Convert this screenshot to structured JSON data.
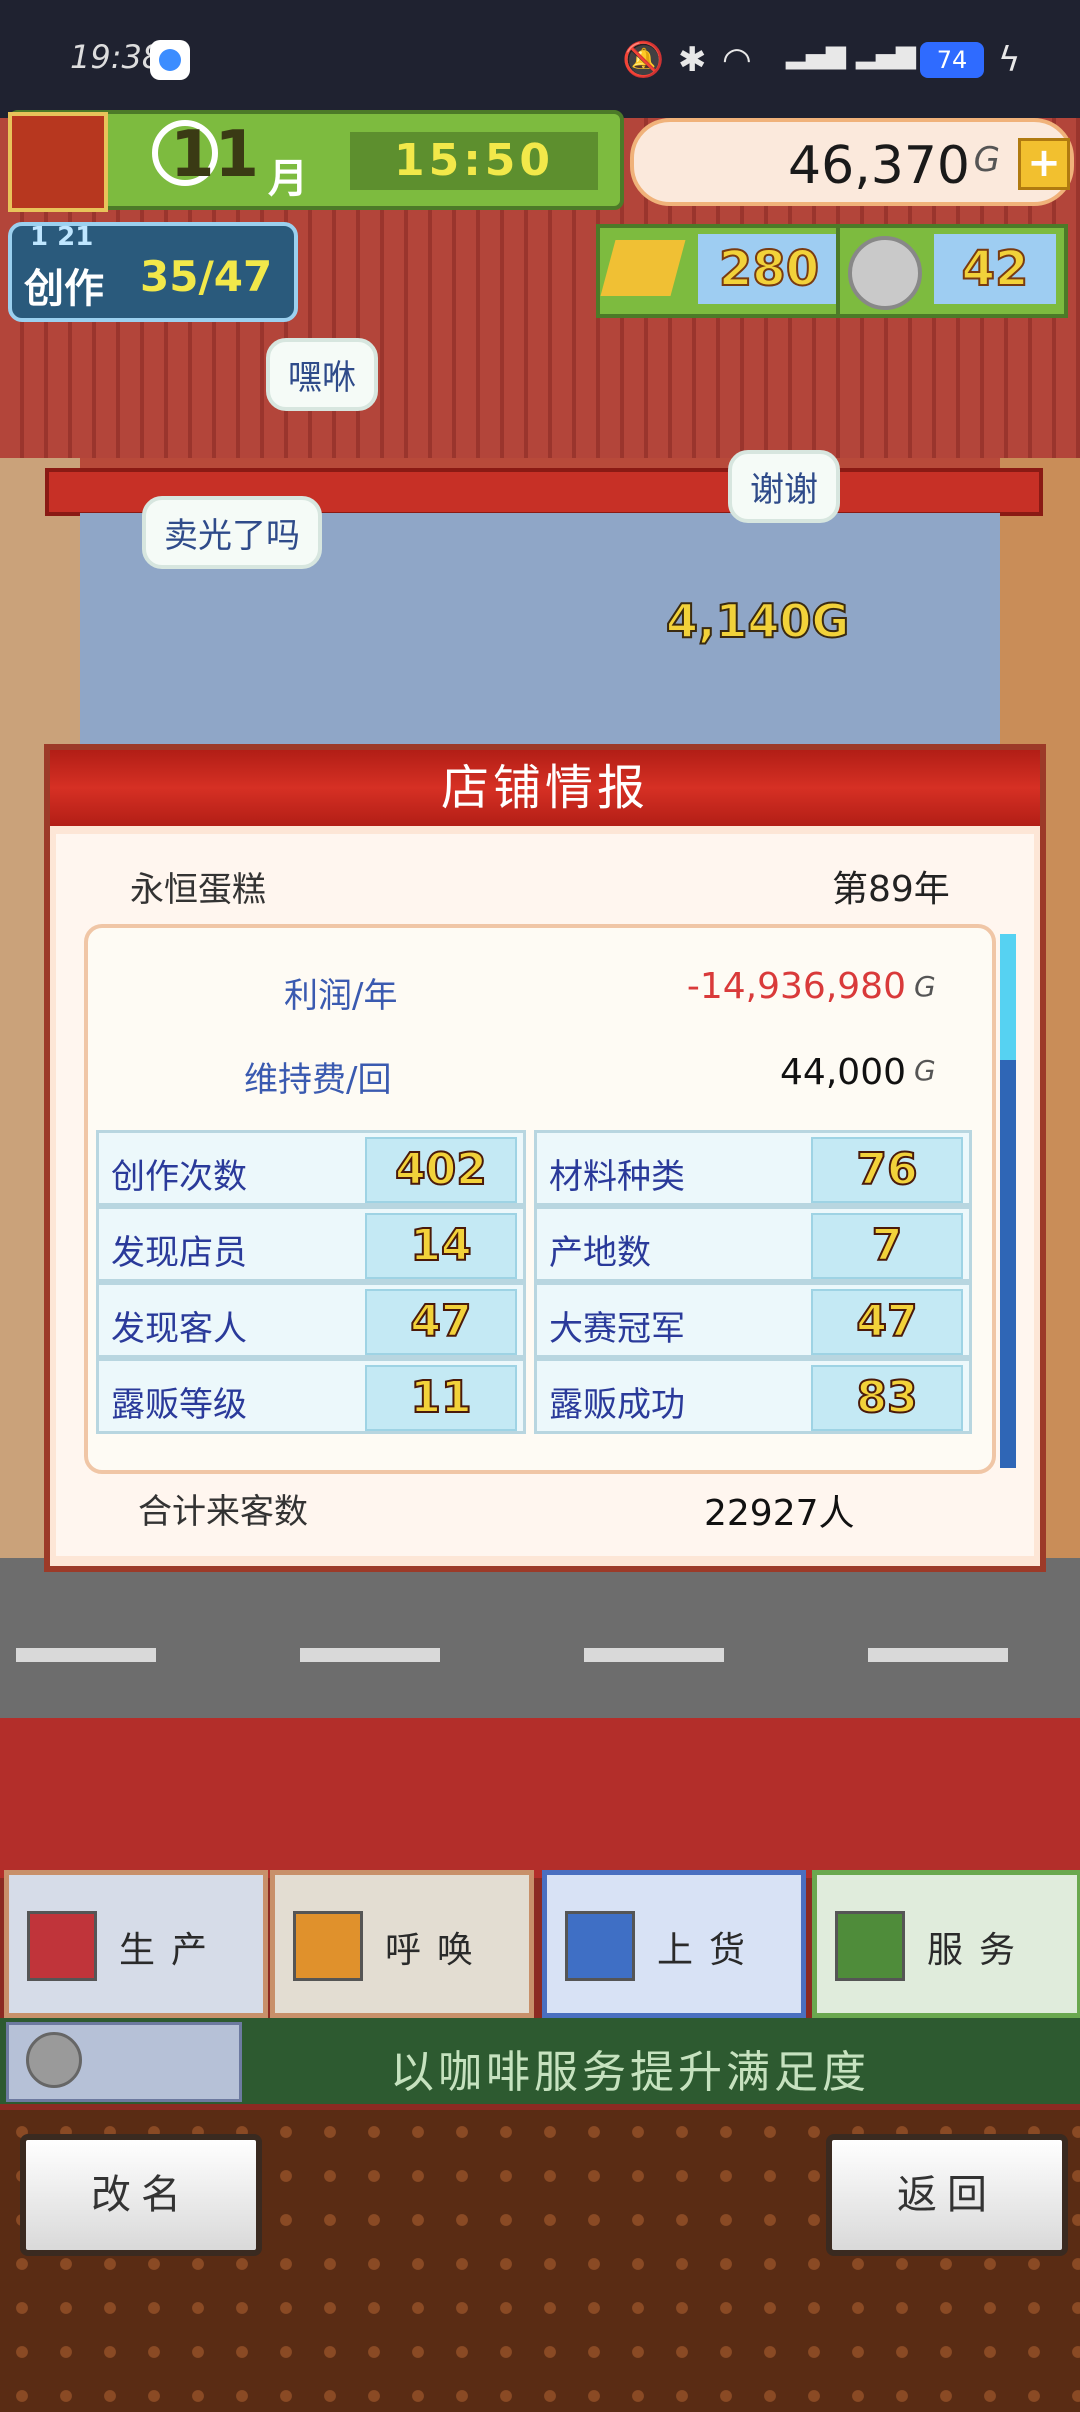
{
  "status_bar": {
    "time": "19:38",
    "battery": "74"
  },
  "hud": {
    "month_number": "11",
    "month_label": "月",
    "clock": "15:50",
    "money": "46,370",
    "money_unit": "G",
    "create_level": "1 21",
    "create_label": "创作",
    "create_count": "35/47",
    "gold_bars": "280",
    "medals": "42"
  },
  "speech_bubbles": [
    "嘿咻",
    "卖光了吗",
    "谢谢"
  ],
  "floating_amount": "4,140G",
  "panel": {
    "title": "店铺情报",
    "shop_name": "永恒蛋糕",
    "year": "第89年",
    "profit_label": "利润/年",
    "profit_value": "-14,936,980",
    "upkeep_label": "维持费/回",
    "upkeep_value": "44,000",
    "unit": "G",
    "stats": [
      {
        "label": "创作次数",
        "value": "402"
      },
      {
        "label": "材料种类",
        "value": "76"
      },
      {
        "label": "发现店员",
        "value": "14"
      },
      {
        "label": "产地数",
        "value": "7"
      },
      {
        "label": "发现客人",
        "value": "47"
      },
      {
        "label": "大赛冠军",
        "value": "47"
      },
      {
        "label": "露贩等级",
        "value": "11"
      },
      {
        "label": "露贩成功",
        "value": "83"
      }
    ],
    "total_label": "合计来客数",
    "total_value": "22927人"
  },
  "actions": [
    {
      "label": "生产",
      "icon": "bread-icon"
    },
    {
      "label": "呼唤",
      "icon": "megaphone-icon"
    },
    {
      "label": "上货",
      "icon": "cake-icon"
    },
    {
      "label": "服务",
      "icon": "coffee-icon"
    }
  ],
  "message": "以咖啡服务提升满足度",
  "bottom_buttons": {
    "rename": "改名",
    "back": "返回"
  },
  "colors": {
    "panel_header": "#c9281e",
    "profit_negative": "#d93a3a",
    "stat_number": "#f2d23a"
  }
}
